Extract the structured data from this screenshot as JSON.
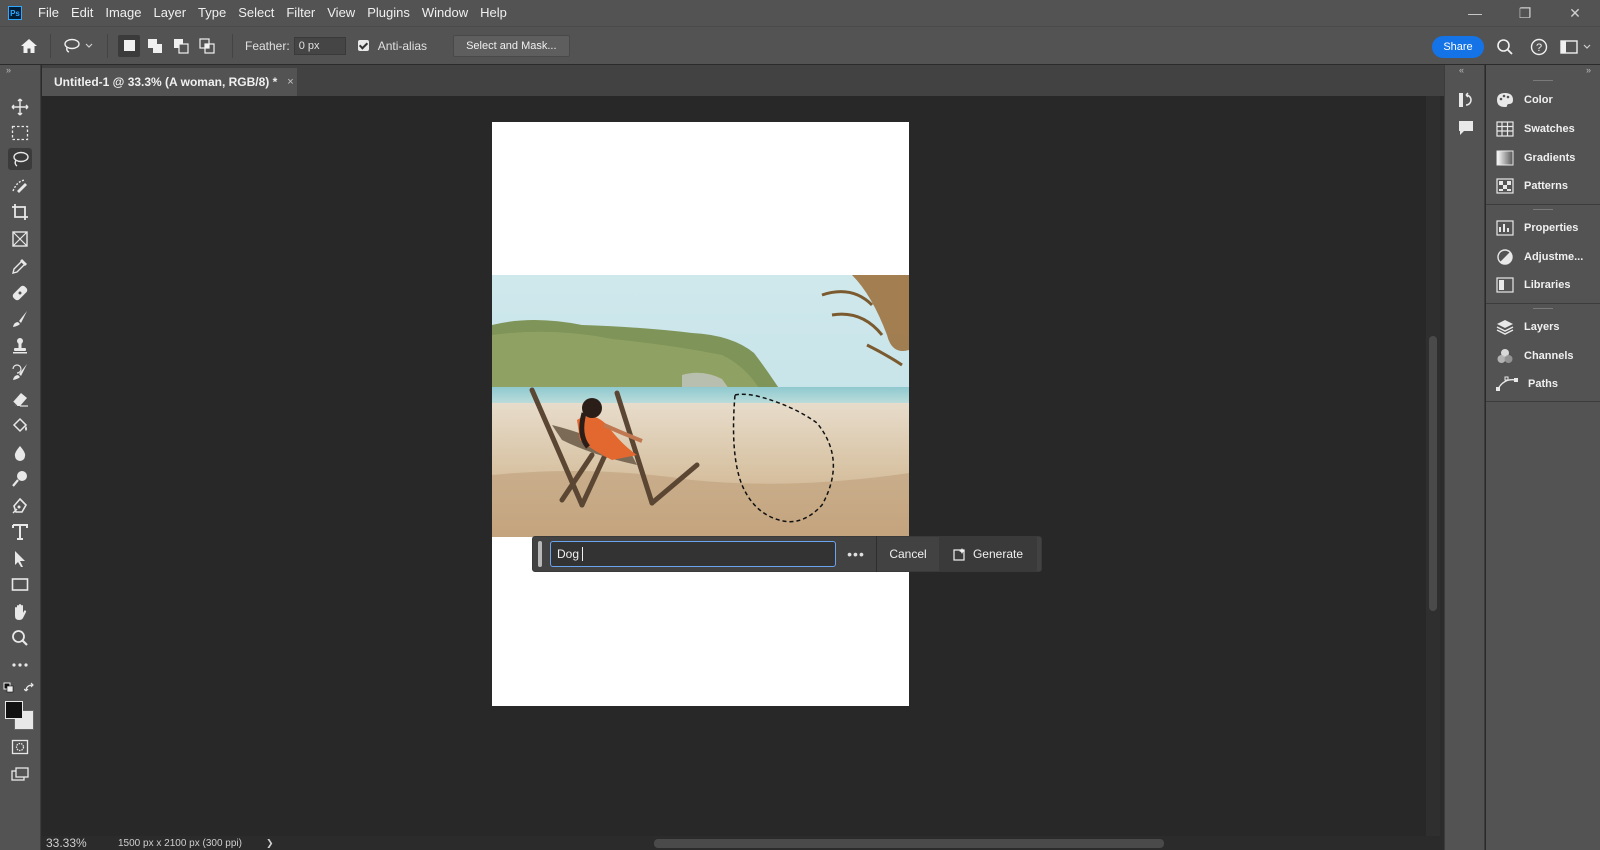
{
  "menu": [
    "File",
    "Edit",
    "Image",
    "Layer",
    "Type",
    "Select",
    "Filter",
    "View",
    "Plugins",
    "Window",
    "Help"
  ],
  "app_logo": "Ps",
  "options": {
    "feather_label": "Feather:",
    "feather_value": "0 px",
    "antialias_label": "Anti-alias",
    "select_mask_label": "Select and Mask...",
    "share_label": "Share"
  },
  "document_tab": {
    "title": "Untitled-1 @ 33.3% (A woman, RGB/8) *",
    "close": "×"
  },
  "generative_bar": {
    "prompt_value": "Dog",
    "more_label": "•••",
    "cancel_label": "Cancel",
    "generate_label": "Generate"
  },
  "status": {
    "zoom": "33.33%",
    "doc_info": "1500 px x 2100 px (300 ppi)",
    "arrow": "❯"
  },
  "panels": [
    {
      "label": "Color",
      "icon": "color-icon"
    },
    {
      "label": "Swatches",
      "icon": "swatches-icon"
    },
    {
      "label": "Gradients",
      "icon": "gradients-icon"
    },
    {
      "label": "Patterns",
      "icon": "patterns-icon"
    },
    {
      "label": "Properties",
      "icon": "properties-icon"
    },
    {
      "label": "Adjustme...",
      "icon": "adjustments-icon"
    },
    {
      "label": "Libraries",
      "icon": "libraries-icon"
    },
    {
      "label": "Layers",
      "icon": "layers-icon"
    },
    {
      "label": "Channels",
      "icon": "channels-icon"
    },
    {
      "label": "Paths",
      "icon": "paths-icon"
    }
  ],
  "colors": {
    "accent": "#1473e6",
    "panel_bg": "#535353",
    "canvas_bg": "#282828"
  }
}
